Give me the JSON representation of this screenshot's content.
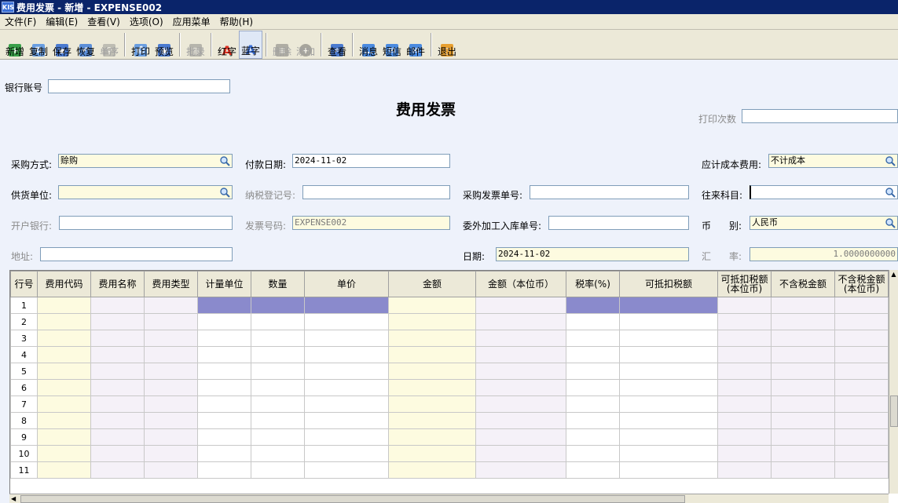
{
  "window": {
    "title": "费用发票 - 新增 - EXPENSE002",
    "app_icon": "KIS"
  },
  "menu": [
    "文件(F)",
    "编辑(E)",
    "查看(V)",
    "选项(O)",
    "应用菜单",
    "帮助(H)"
  ],
  "toolbar": {
    "new": "新增",
    "copy": "复制",
    "save": "保存",
    "restore": "恢复",
    "sequence": "单序",
    "print": "打印",
    "preview": "预览",
    "batch": "批录",
    "red": "红字",
    "blue": "蓝字",
    "delete": "删除",
    "add": "添加",
    "view": "查看",
    "message": "消息",
    "sms": "短信",
    "mail": "邮件",
    "exit": "退出"
  },
  "form": {
    "title": "费用发票",
    "bank_account": {
      "label": "银行账号",
      "value": ""
    },
    "print_count": {
      "label": "打印次数",
      "value": ""
    },
    "purchase_mode": {
      "label": "采购方式:",
      "value": "赊购"
    },
    "pay_date": {
      "label": "付款日期:",
      "value": "2024-11-02"
    },
    "cost_accrual": {
      "label": "应计成本费用:",
      "value": "不计成本"
    },
    "supplier": {
      "label": "供货单位:",
      "value": ""
    },
    "tax_reg_no": {
      "label": "纳税登记号:",
      "value": ""
    },
    "purchase_invoice_no": {
      "label": "采购发票单号:",
      "value": ""
    },
    "account_subject": {
      "label": "往来科目:",
      "value": ""
    },
    "bank": {
      "label": "开户银行:",
      "value": ""
    },
    "invoice_no": {
      "label": "发票号码:",
      "value": "EXPENSE002"
    },
    "outsource_no": {
      "label": "委外加工入库单号:",
      "value": ""
    },
    "currency": {
      "label_a": "币",
      "label_b": "别:",
      "value": "人民币"
    },
    "address": {
      "label": "地址:",
      "value": ""
    },
    "date": {
      "label": "日期:",
      "value": "2024-11-02"
    },
    "rate": {
      "label_a": "汇",
      "label_b": "率:",
      "value": "1.0000000000"
    }
  },
  "grid": {
    "columns": [
      "行号",
      "费用代码",
      "费用名称",
      "费用类型",
      "计量单位",
      "数量",
      "单价",
      "金额",
      "金额（本位币）",
      "税率(%)",
      "可抵扣税额",
      "可抵扣税额(本位币)",
      "不含税金额",
      "不含税金额(本位币)"
    ],
    "rows": [
      "1",
      "2",
      "3",
      "4",
      "5",
      "6",
      "7",
      "8",
      "9",
      "10",
      "11"
    ]
  }
}
